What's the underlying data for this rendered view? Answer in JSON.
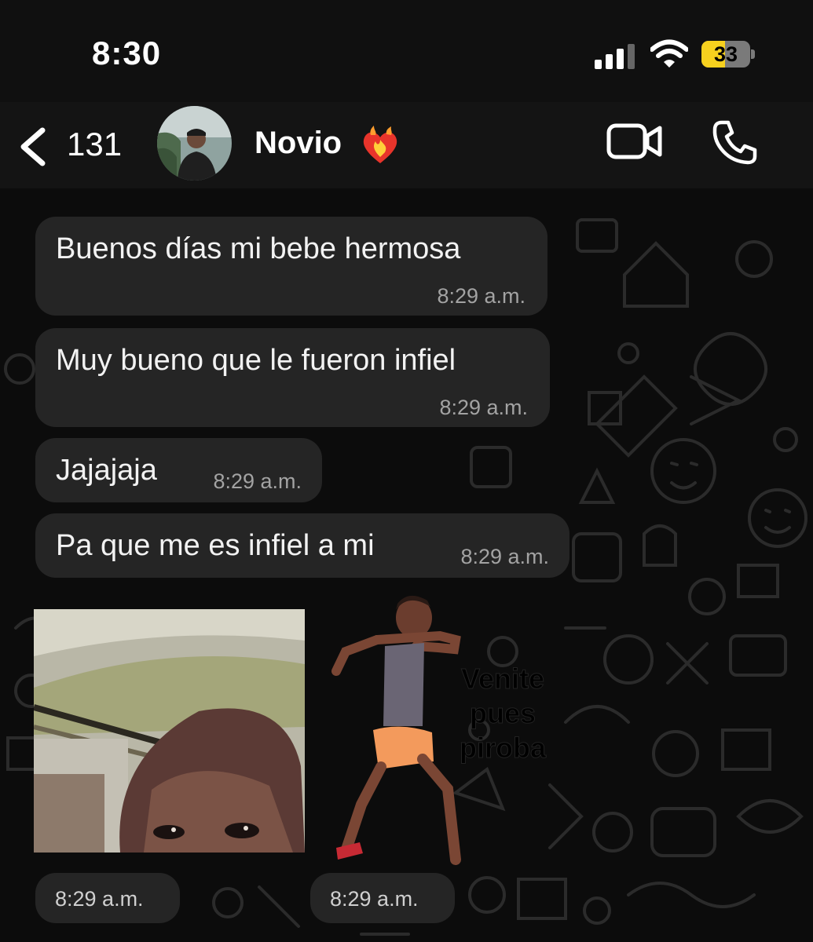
{
  "status_bar": {
    "time": "8:30",
    "battery_percent": "33",
    "battery_level": 0.33
  },
  "header": {
    "back_count": "131",
    "contact_name": "Novio",
    "icons": [
      "back-chevron-icon",
      "heart-on-fire-icon",
      "video-call-icon",
      "phone-call-icon"
    ]
  },
  "messages": [
    {
      "text": "Buenos días mi bebe hermosa",
      "time": "8:29 a.m."
    },
    {
      "text": "Muy bueno que le fueron infiel",
      "time": "8:29 a.m."
    },
    {
      "text": "Jajajaja",
      "time": "8:29 a.m."
    },
    {
      "text": "Pa que me es infiel a mi",
      "time": "8:29 a.m."
    }
  ],
  "media": [
    {
      "kind": "video-thumbnail",
      "time": "8:29 a.m."
    },
    {
      "kind": "sticker",
      "caption": "Venite pues piroba",
      "time": "8:29 a.m."
    }
  ],
  "colors": {
    "bubble": "#252525",
    "battery": "#f7d11e",
    "background": "#0b0b0b"
  }
}
